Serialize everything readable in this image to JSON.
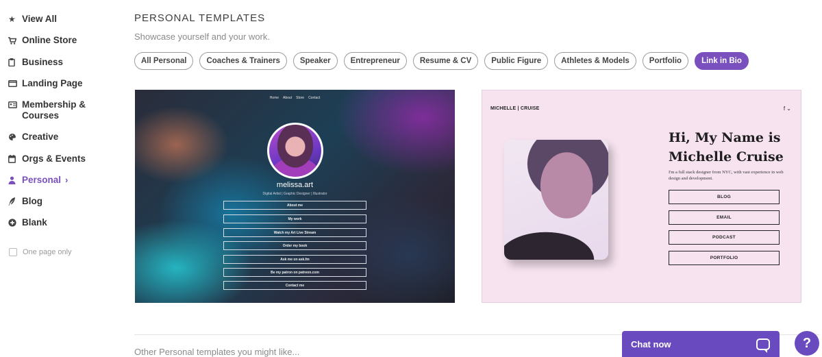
{
  "sidebar": {
    "items": [
      {
        "label": "View All",
        "icon": "star-icon",
        "glyph": "★"
      },
      {
        "label": "Online Store",
        "icon": "cart-icon",
        "glyph": "🛒"
      },
      {
        "label": "Business",
        "icon": "clipboard-icon",
        "glyph": "📋"
      },
      {
        "label": "Landing Page",
        "icon": "window-icon",
        "glyph": "▭"
      },
      {
        "label": "Membership &",
        "label2": "Courses",
        "icon": "id-card-icon",
        "glyph": "▤"
      },
      {
        "label": "Creative",
        "icon": "palette-icon",
        "glyph": "◕"
      },
      {
        "label": "Orgs & Events",
        "icon": "calendar-icon",
        "glyph": "▦"
      },
      {
        "label": "Personal",
        "icon": "person-icon",
        "glyph": "👤",
        "active": true
      },
      {
        "label": "Blog",
        "icon": "quill-icon",
        "glyph": "✒"
      },
      {
        "label": "Blank",
        "icon": "plus-circle-icon",
        "glyph": "⊕"
      }
    ],
    "one_page_label": "One page only",
    "active_chevron": "›"
  },
  "header": {
    "title": "PERSONAL TEMPLATES",
    "subtitle": "Showcase yourself and your work."
  },
  "filters": [
    {
      "label": "All Personal"
    },
    {
      "label": "Coaches & Trainers"
    },
    {
      "label": "Speaker"
    },
    {
      "label": "Entrepreneur"
    },
    {
      "label": "Resume & CV"
    },
    {
      "label": "Public Figure"
    },
    {
      "label": "Athletes & Models"
    },
    {
      "label": "Portfolio"
    },
    {
      "label": "Link in Bio",
      "active": true
    }
  ],
  "template1": {
    "nav": [
      "Home",
      "About",
      "Store",
      "Contact"
    ],
    "name": "melissa.art",
    "role": "Digital Artist | Graphic Designer | Illustrator",
    "links": [
      "About me",
      "My work",
      "Watch my Art Live Stream",
      "Order my book",
      "Ask me on ask.fm",
      "Be my patron on patreon.com",
      "Contact me"
    ]
  },
  "template2": {
    "brand": "MICHELLE | CRUISE",
    "social": "f ⌄",
    "heading_line1": "Hi, My Name is",
    "heading_line2": "Michelle Cruise",
    "description": "I'm a full stack designer from NYC, with vast experience in web design and development.",
    "buttons": [
      "BLOG",
      "EMAIL",
      "PODCAST",
      "PORTFOLIO"
    ]
  },
  "footer": {
    "other_label": "Other Personal templates you might like...",
    "chat_label": "Chat now",
    "help_label": "?"
  },
  "colors": {
    "accent": "#7a50bf",
    "chat": "#6a4bbf",
    "template2_bg": "#f7e3f0"
  }
}
